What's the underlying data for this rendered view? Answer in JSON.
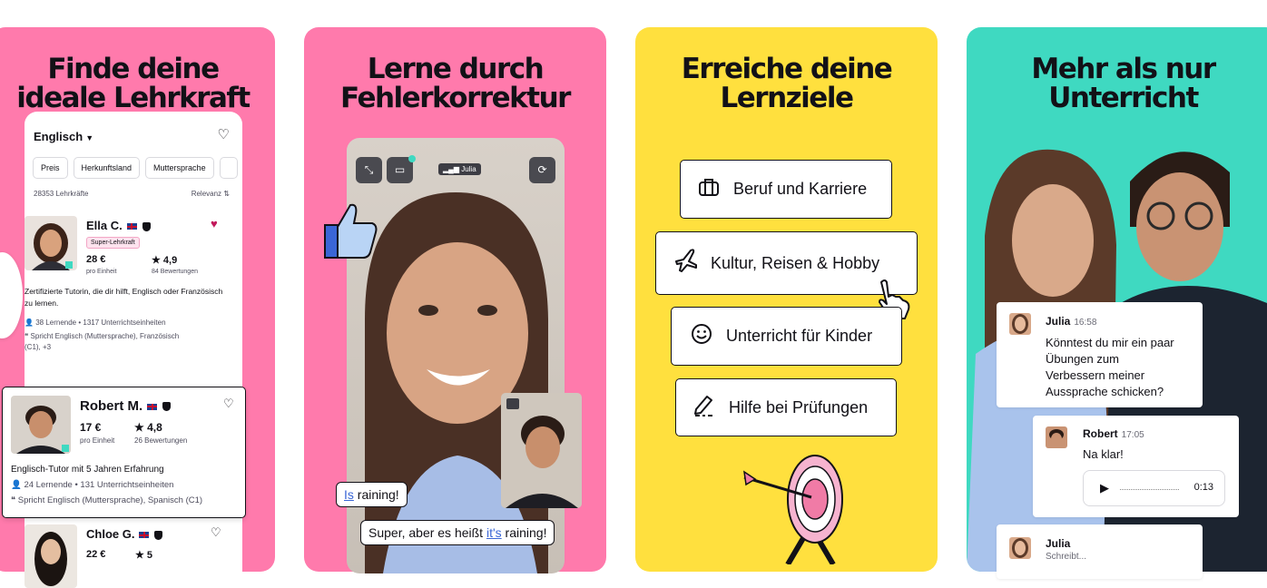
{
  "panels": [
    {
      "title_line1": "Finde deine",
      "title_line2": "ideale Lehrkraft",
      "bg": "#ff7aac"
    },
    {
      "title_line1": "Lerne durch",
      "title_line2": "Fehlerkorrektur",
      "bg": "#ff7aac"
    },
    {
      "title_line1": "Erreiche deine",
      "title_line2": "Lernziele",
      "bg": "#ffe03e"
    },
    {
      "title_line1": "Mehr als nur",
      "title_line2": "Unterricht",
      "bg": "#3fd9c1"
    }
  ],
  "search": {
    "language": "Englisch",
    "filters": [
      "Preis",
      "Herkunftsland",
      "Muttersprache"
    ],
    "count": "28353 Lehrkräfte",
    "sort": "Relevanz"
  },
  "tutors": [
    {
      "name": "Ella C.",
      "badge": "Super-Lehrkraft",
      "price": "28 €",
      "price_sub": "pro Einheit",
      "rating": "★ 4,9",
      "reviews": "84 Bewertungen",
      "description": "Zertifizierte Tutorin, die dir hilft, Englisch oder Französisch zu lernen.",
      "stats": "38 Lernende • 1317 Unterrichtseinheiten",
      "speaks": "Spricht Englisch (Muttersprache), Französisch (C1), +3"
    },
    {
      "name": "Robert M.",
      "price": "17 €",
      "price_sub": "pro Einheit",
      "rating": "★ 4,8",
      "reviews": "26 Bewertungen",
      "description": "Englisch-Tutor mit 5 Jahren Erfahrung",
      "stats": "24 Lernende • 131 Unterrichtseinheiten",
      "speaks": "Spricht Englisch (Muttersprache), Spanisch (C1)"
    },
    {
      "name": "Chloe G.",
      "price": "22 €",
      "rating": "★ 5"
    }
  ],
  "video": {
    "participant": "Julia",
    "correction_wrong_word": "Is",
    "correction_wrong_rest": " raining!",
    "correction_prefix": "Super, aber es heißt ",
    "correction_right": "it's",
    "correction_suffix": " raining!"
  },
  "goals": [
    {
      "label": "Beruf und Karriere",
      "icon": "briefcase-icon"
    },
    {
      "label": "Kultur, Reisen & Hobby",
      "icon": "airplane-icon"
    },
    {
      "label": "Unterricht für Kinder",
      "icon": "smiley-icon"
    },
    {
      "label": "Hilfe bei Prüfungen",
      "icon": "pencil-icon"
    }
  ],
  "chat": [
    {
      "name": "Julia",
      "time": "16:58",
      "text_lines": [
        "Könntest du mir ein paar",
        "Übungen zum",
        "Verbessern meiner",
        "Aussprache schicken?"
      ]
    },
    {
      "name": "Robert",
      "time": "17:05",
      "text": "Na klar!",
      "audio_duration": "0:13"
    },
    {
      "name": "Julia",
      "status": "Schreibt..."
    }
  ],
  "colors": {
    "pink": "#ff7aac",
    "yellow": "#ffe03e",
    "teal": "#3fd9c1",
    "ink": "#121117",
    "heart": "#c2185b",
    "link": "#3a66d6"
  }
}
